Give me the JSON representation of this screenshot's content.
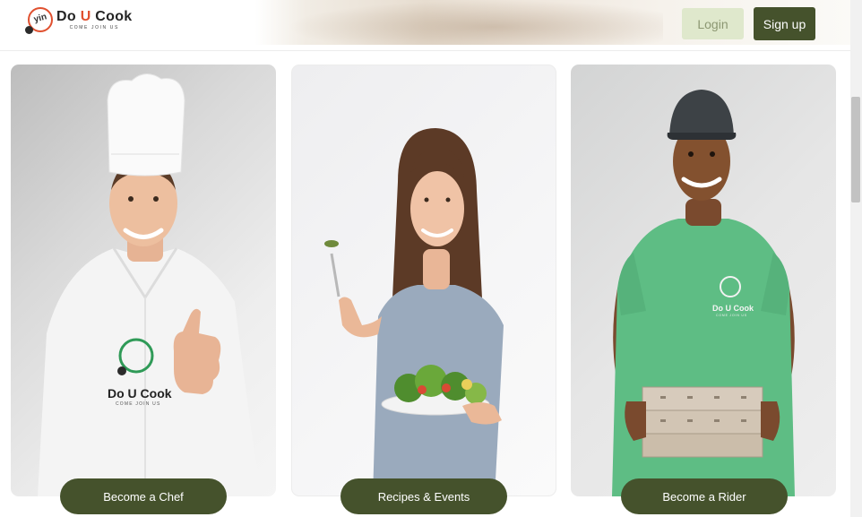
{
  "header": {
    "logo": {
      "mark_text": "yin",
      "title_prefix": "Do ",
      "title_accent": "U",
      "title_suffix": " Cook",
      "tagline": "COME JOIN US"
    },
    "login_label": "Login",
    "signup_label": "Sign up"
  },
  "cards": [
    {
      "photo": "chef-photo",
      "cta_label": "Become a Chef",
      "shirt_logo": "Do U Cook",
      "shirt_tagline": "COME JOIN US"
    },
    {
      "photo": "woman-salad-photo",
      "cta_label": "Recipes & Events"
    },
    {
      "photo": "delivery-rider-photo",
      "cta_label": "Become a Rider",
      "shirt_logo": "Do U Cook",
      "shirt_tagline": "COME JOIN US"
    }
  ],
  "colors": {
    "primary": "#45522c",
    "login_bg": "#dfe8cc",
    "accent": "#e0502f"
  }
}
